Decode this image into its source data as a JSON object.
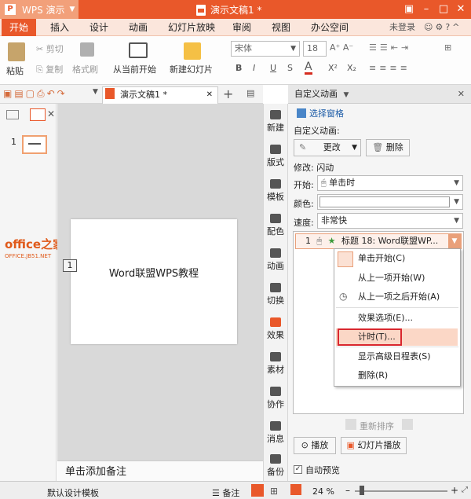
{
  "app": {
    "name": "WPS 演示",
    "doc_title": "演示文稿1 *",
    "user": "未登录"
  },
  "menu": [
    "开始",
    "插入",
    "设计",
    "动画",
    "幻灯片放映",
    "审阅",
    "视图",
    "办公空间"
  ],
  "ribbon": {
    "paste": "粘贴",
    "cut": "剪切",
    "copy": "复制",
    "format_painter": "格式刷",
    "from_current": "从当前开始",
    "new_slide": "新建幻灯片",
    "font_name": "宋体",
    "font_size": "18",
    "bold": "B",
    "italic": "I",
    "underline": "U",
    "strike": "S",
    "fontcolor": "A",
    "superscript": "X²",
    "subscript": "X₂"
  },
  "doc_tab": "演示文稿1 *",
  "thumbnail": {
    "number": "1"
  },
  "slide": {
    "title_text": "Word联盟WPS教程",
    "anim_marker": "1"
  },
  "notes_placeholder": "单击添加备注",
  "side_tools": [
    "新建",
    "版式",
    "模板",
    "配色",
    "动画",
    "切换",
    "效果",
    "素材",
    "协作",
    "消息",
    "备份"
  ],
  "anim_pane": {
    "title": "自定义动画",
    "select_pane": "选择窗格",
    "custom_label": "自定义动画:",
    "change_btn": "更改",
    "delete_btn": "删除",
    "modify": "修改: 闪动",
    "start_label": "开始:",
    "start_value": "单击时",
    "color_label": "颜色:",
    "speed_label": "速度:",
    "speed_value": "非常快",
    "item": {
      "index": "1",
      "text": "标题 18: Word联盟WP..."
    },
    "reorder": "重新排序",
    "play_btn": "播放",
    "slideshow_btn": "幻灯片播放",
    "auto_preview": "自动预览"
  },
  "context_menu": [
    "单击开始(C)",
    "从上一项开始(W)",
    "从上一项之后开始(A)",
    "效果选项(E)...",
    "计时(T)...",
    "显示高级日程表(S)",
    "删除(R)"
  ],
  "status": {
    "template": "默认设计模板",
    "notes": "备注",
    "zoom": "24 %"
  },
  "watermark": {
    "line1": "office之家",
    "line2": "OFFICE.JB51.NET"
  }
}
